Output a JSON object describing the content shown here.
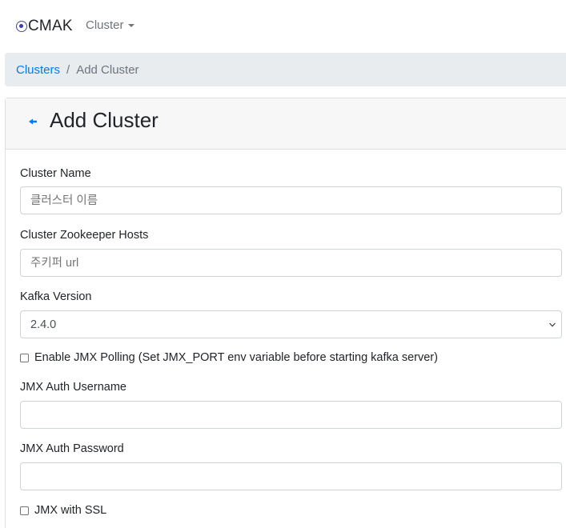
{
  "navbar": {
    "brand": "CMAK",
    "brand_icon": "cmak-logo-icon",
    "cluster_menu": "Cluster"
  },
  "breadcrumb": {
    "root": "Clusters",
    "separator": "/",
    "current": "Add Cluster"
  },
  "page": {
    "title": "Add Cluster",
    "back_icon": "arrow-left-icon"
  },
  "form": {
    "cluster_name": {
      "label": "Cluster Name",
      "placeholder": "클러스터 이름",
      "value": ""
    },
    "zookeeper_hosts": {
      "label": "Cluster Zookeeper Hosts",
      "placeholder": "주키퍼 url",
      "value": ""
    },
    "kafka_version": {
      "label": "Kafka Version",
      "selected": "2.4.0"
    },
    "jmx_polling": {
      "label": "Enable JMX Polling (Set JMX_PORT env variable before starting kafka server)",
      "checked": false
    },
    "jmx_username": {
      "label": "JMX Auth Username",
      "value": ""
    },
    "jmx_password": {
      "label": "JMX Auth Password",
      "value": ""
    },
    "jmx_ssl": {
      "label": "JMX with SSL",
      "checked": false
    }
  },
  "colors": {
    "link": "#007bff",
    "muted": "#6c757d",
    "breadcrumb_bg": "#e9ecef",
    "card_header_bg": "#f7f7f7"
  }
}
